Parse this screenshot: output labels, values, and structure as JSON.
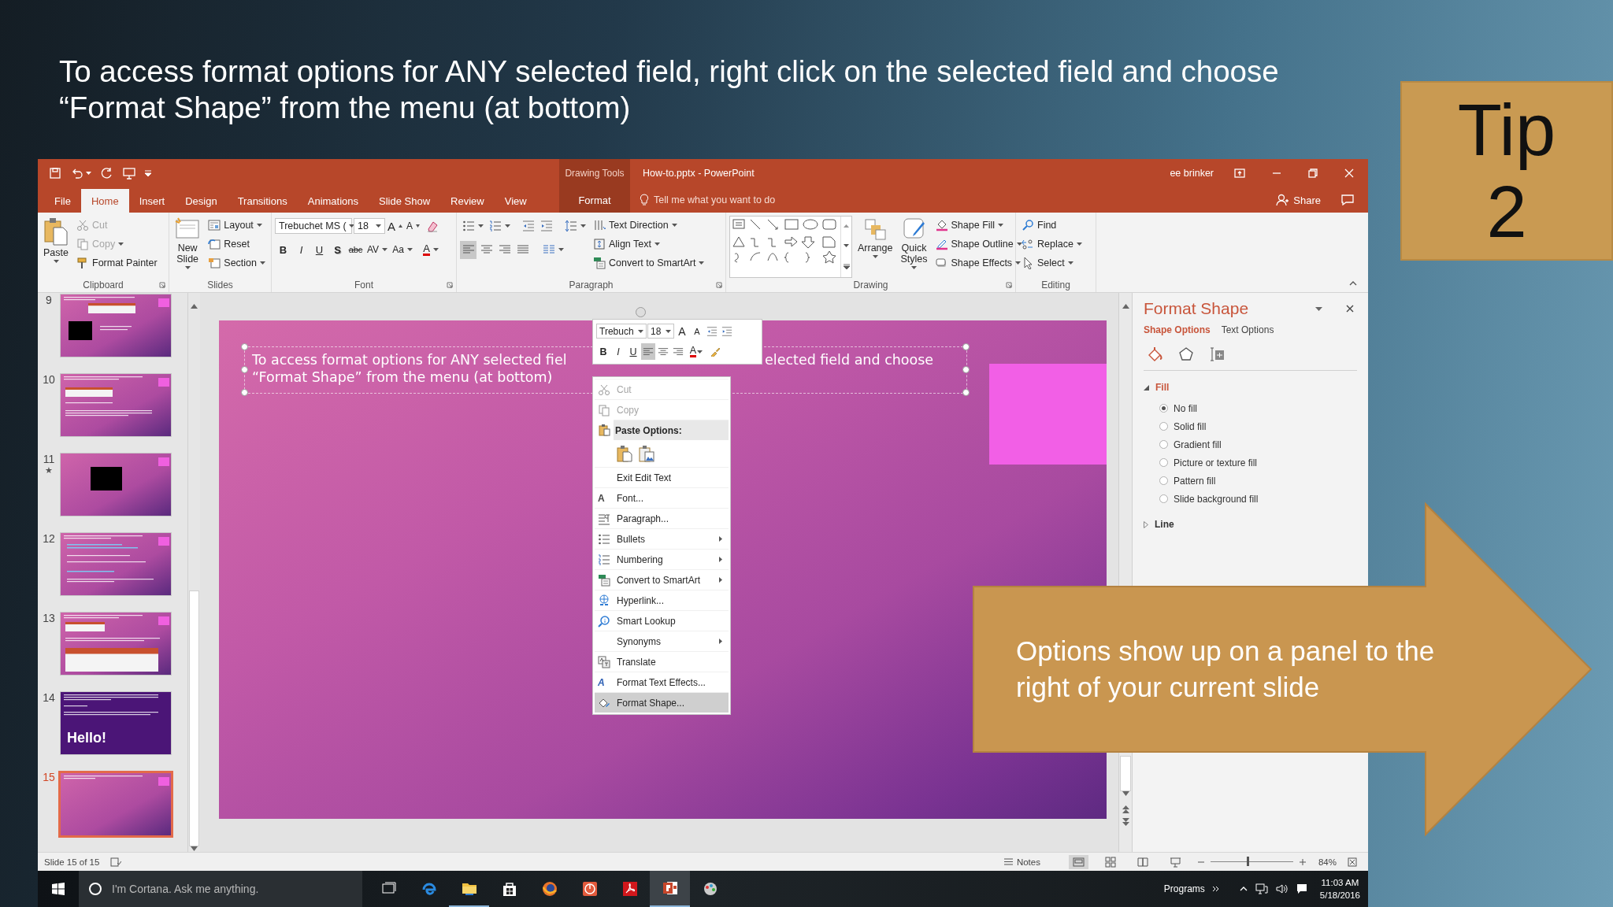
{
  "heading_lines": [
    "To access format options for ANY selected field, right click on the selected field and choose",
    "“Format Shape” from the menu (at bottom)"
  ],
  "tip": {
    "label": "Tip",
    "number": "2"
  },
  "window": {
    "context_label": "Drawing Tools",
    "title": "How-to.pptx - PowerPoint",
    "user": "ee brinker",
    "tabs": [
      {
        "label": "File",
        "selected": false,
        "kind": "file"
      },
      {
        "label": "Home",
        "selected": true,
        "kind": "normal"
      },
      {
        "label": "Insert",
        "selected": false,
        "kind": "normal"
      },
      {
        "label": "Design",
        "selected": false,
        "kind": "normal"
      },
      {
        "label": "Transitions",
        "selected": false,
        "kind": "normal"
      },
      {
        "label": "Animations",
        "selected": false,
        "kind": "normal"
      },
      {
        "label": "Slide Show",
        "selected": false,
        "kind": "normal"
      },
      {
        "label": "Review",
        "selected": false,
        "kind": "normal"
      },
      {
        "label": "View",
        "selected": false,
        "kind": "normal"
      },
      {
        "label": "Format",
        "selected": false,
        "kind": "contextual"
      }
    ],
    "tell_me": "Tell me what you want to do",
    "share": "Share",
    "ribbon": {
      "groups": [
        {
          "label": "Clipboard",
          "kind": "clipboard",
          "commands": [
            {
              "label": "Paste",
              "disabled": false
            },
            {
              "label": "Cut",
              "disabled": true
            },
            {
              "label": "Copy",
              "disabled": true
            },
            {
              "label": "Format Painter",
              "disabled": false
            }
          ]
        },
        {
          "label": "Slides",
          "kind": "slides",
          "commands": [
            {
              "label": "New Slide"
            },
            {
              "label": "Layout"
            },
            {
              "label": "Reset"
            },
            {
              "label": "Section"
            }
          ]
        },
        {
          "label": "Font",
          "kind": "font",
          "font_name": "Trebuchet MS (",
          "font_size": "18",
          "grow": "A",
          "shrink": "A",
          "format_buttons": [
            "B",
            "I",
            "U",
            "S",
            "abc",
            "AV",
            "Aa"
          ],
          "color_button": "A"
        },
        {
          "label": "Paragraph",
          "kind": "paragraph",
          "align": [
            {
              "selected": true
            },
            {
              "selected": false
            },
            {
              "selected": false
            },
            {
              "selected": false
            }
          ],
          "commands": [
            {
              "label": "Text Direction"
            },
            {
              "label": "Align Text"
            },
            {
              "label": "Convert to SmartArt"
            }
          ]
        },
        {
          "label": "Drawing",
          "kind": "drawing",
          "commands": [
            {
              "label": "Arrange"
            },
            {
              "label": "Quick Styles"
            },
            {
              "label": "Shape Fill"
            },
            {
              "label": "Shape Outline"
            },
            {
              "label": "Shape Effects"
            }
          ]
        },
        {
          "label": "Editing",
          "kind": "editing",
          "commands": [
            {
              "label": "Find"
            },
            {
              "label": "Replace"
            },
            {
              "label": "Select"
            }
          ]
        }
      ]
    }
  },
  "thumbnails": [
    {
      "number": "9",
      "kind": "video-notes",
      "selected": false
    },
    {
      "number": "10",
      "kind": "screenshot-notes",
      "selected": false
    },
    {
      "number": "11",
      "kind": "video",
      "selected": false,
      "marker": "★"
    },
    {
      "number": "12",
      "kind": "links",
      "selected": false
    },
    {
      "number": "13",
      "kind": "screenshots",
      "selected": false
    },
    {
      "number": "14",
      "kind": "title",
      "selected": false,
      "title": "Hello!"
    },
    {
      "number": "15",
      "kind": "text",
      "selected": true
    }
  ],
  "slide": {
    "text_pieces": [
      "To access format options for ANY selected fiel",
      "elected field and choose",
      "“Format Shape” from the menu (at bottom)"
    ],
    "selected": true
  },
  "mini_toolbar": {
    "font_name": "Trebuch",
    "font_size": "18",
    "grow": "A",
    "shrink": "A",
    "format_buttons": [
      "B",
      "I",
      "U"
    ],
    "align": [
      {
        "selected": true
      },
      {
        "selected": false
      },
      {
        "selected": false
      }
    ],
    "color_button": "A"
  },
  "context_menu": [
    {
      "kind": "item",
      "label": "Cut",
      "disabled": true,
      "selected": false,
      "submenu": false
    },
    {
      "kind": "item",
      "label": "Copy",
      "disabled": true,
      "selected": false,
      "submenu": false
    },
    {
      "kind": "header",
      "label": "Paste Options:"
    },
    {
      "kind": "paste-options"
    },
    {
      "kind": "item",
      "label": "Exit Edit Text",
      "disabled": false,
      "selected": false,
      "submenu": false
    },
    {
      "kind": "item",
      "label": "Font...",
      "glyph": "A",
      "disabled": false,
      "selected": false,
      "submenu": false
    },
    {
      "kind": "item",
      "label": "Paragraph...",
      "disabled": false,
      "selected": false,
      "submenu": false
    },
    {
      "kind": "item",
      "label": "Bullets",
      "disabled": false,
      "selected": false,
      "submenu": true
    },
    {
      "kind": "item",
      "label": "Numbering",
      "disabled": false,
      "selected": false,
      "submenu": true
    },
    {
      "kind": "item",
      "label": "Convert to SmartArt",
      "disabled": false,
      "selected": false,
      "submenu": true
    },
    {
      "kind": "item",
      "label": "Hyperlink...",
      "disabled": false,
      "selected": false,
      "submenu": false
    },
    {
      "kind": "item",
      "label": "Smart Lookup",
      "disabled": false,
      "selected": false,
      "submenu": false
    },
    {
      "kind": "item",
      "label": "Synonyms",
      "disabled": false,
      "selected": false,
      "submenu": true
    },
    {
      "kind": "item",
      "label": "Translate",
      "disabled": false,
      "selected": false,
      "submenu": false
    },
    {
      "kind": "item",
      "label": "Format Text Effects...",
      "glyph": "A",
      "disabled": false,
      "selected": false,
      "submenu": false
    },
    {
      "kind": "item",
      "label": "Format Shape...",
      "disabled": false,
      "selected": true,
      "submenu": false
    }
  ],
  "format_pane": {
    "title": "Format Shape",
    "tabs": [
      {
        "label": "Shape Options",
        "selected": true
      },
      {
        "label": "Text Options",
        "selected": false
      }
    ],
    "icon_tabs": [
      {
        "selected": true
      },
      {
        "selected": false
      },
      {
        "selected": false
      }
    ],
    "sections": [
      {
        "label": "Fill",
        "expanded": true,
        "options": [
          {
            "label": "No fill",
            "checked": true
          },
          {
            "label": "Solid fill",
            "checked": false
          },
          {
            "label": "Gradient fill",
            "checked": false
          },
          {
            "label": "Picture or texture fill",
            "checked": false
          },
          {
            "label": "Pattern fill",
            "checked": false
          },
          {
            "label": "Slide background fill",
            "checked": false
          }
        ]
      },
      {
        "label": "Line",
        "expanded": false
      }
    ]
  },
  "status_bar": {
    "slide_info": "Slide 15 of 15",
    "notes": "Notes",
    "views": [
      {
        "selected": true
      },
      {
        "selected": false
      },
      {
        "selected": false
      },
      {
        "selected": false
      }
    ],
    "level": 0.45,
    "zoom": "84%"
  },
  "taskbar": {
    "search_placeholder": "I'm Cortana. Ask me anything.",
    "apps": [
      {
        "running": false,
        "active": false
      },
      {
        "running": false,
        "active": false
      },
      {
        "running": true,
        "active": false
      },
      {
        "running": false,
        "active": false
      },
      {
        "running": false,
        "active": false
      },
      {
        "running": false,
        "active": false
      },
      {
        "running": false,
        "active": false
      },
      {
        "running": true,
        "active": true
      },
      {
        "running": false,
        "active": false
      }
    ],
    "tray_label": "Programs",
    "time": "11:03 AM",
    "date": "5/18/2016"
  },
  "callout_lines": [
    "Options show up on a panel to the",
    "right of your current slide"
  ]
}
